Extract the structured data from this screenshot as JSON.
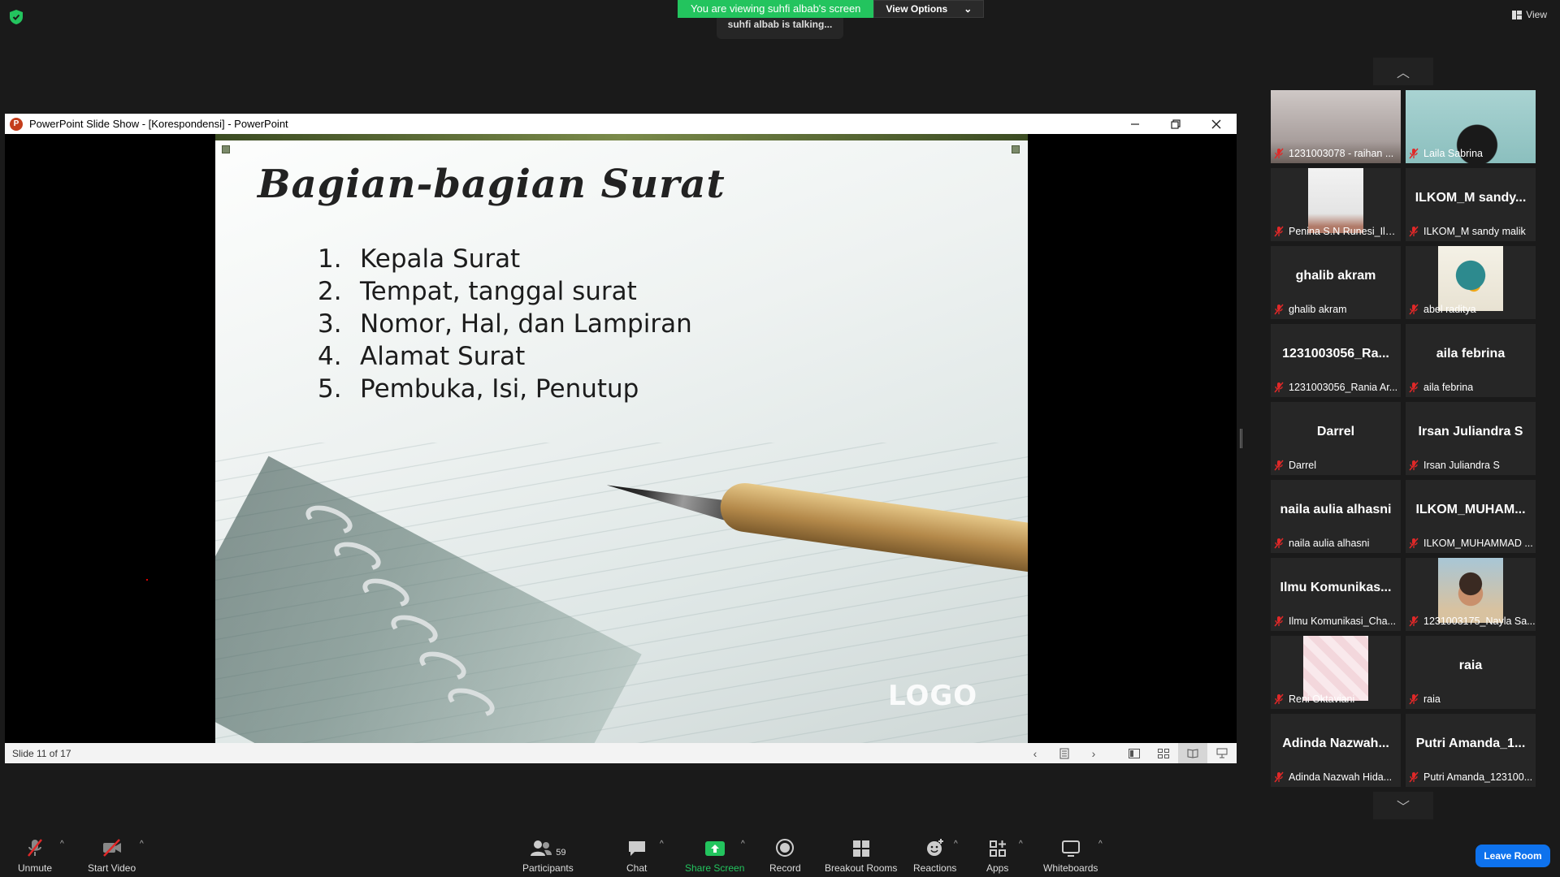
{
  "banner": {
    "viewing": "You are viewing suhfi albab's screen",
    "view_options": "View Options",
    "talking": "suhfi albab is talking..."
  },
  "top_view_label": "View",
  "ppt": {
    "title": "PowerPoint Slide Show - [Korespondensi] - PowerPoint",
    "status": "Slide 11 of 17"
  },
  "slide": {
    "title": "Bagian-bagian Surat",
    "items": [
      {
        "num": "1.",
        "text": "Kepala Surat"
      },
      {
        "num": "2.",
        "text": "Tempat, tanggal surat"
      },
      {
        "num": "3.",
        "text": "Nomor, Hal, dan Lampiran"
      },
      {
        "num": "4.",
        "text": "Alamat Surat"
      },
      {
        "num": "5.",
        "text": "Pembuka, Isi, Penutup"
      }
    ],
    "logo": "LOGO"
  },
  "participants": [
    {
      "big": "",
      "label": "1231003078 - raihan ..."
    },
    {
      "big": "",
      "label": "Laila  Sabrina"
    },
    {
      "big": "",
      "label": "Penina S.N Runesi_Ilm..."
    },
    {
      "big": "ILKOM_M  sandy...",
      "label": "ILKOM_M sandy malik"
    },
    {
      "big": "ghalib akram",
      "label": "ghalib akram"
    },
    {
      "big": "",
      "label": "abel raditya"
    },
    {
      "big": "1231003056_Ra...",
      "label": "1231003056_Rania Ar..."
    },
    {
      "big": "aila febrina",
      "label": "aila febrina"
    },
    {
      "big": "Darrel",
      "label": "Darrel"
    },
    {
      "big": "Irsan Juliandra S",
      "label": "Irsan Juliandra S"
    },
    {
      "big": "naila aulia alhasni",
      "label": "naila aulia alhasni"
    },
    {
      "big": "ILKOM_MUHAM...",
      "label": "ILKOM_MUHAMMAD ..."
    },
    {
      "big": "Ilmu  Komunikas...",
      "label": "Ilmu Komunikasi_Cha..."
    },
    {
      "big": "",
      "label": "1231003175_Nayla Sa..."
    },
    {
      "big": "",
      "label": "Reni Oktaviani"
    },
    {
      "big": "raia",
      "label": "raia"
    },
    {
      "big": "Adinda  Nazwah...",
      "label": "Adinda Nazwah Hida..."
    },
    {
      "big": "Putri  Amanda_1...",
      "label": "Putri Amanda_123100..."
    }
  ],
  "toolbar": {
    "unmute": "Unmute",
    "start_video": "Start Video",
    "participants": "Participants",
    "participants_count": "59",
    "chat": "Chat",
    "share_screen": "Share Screen",
    "record": "Record",
    "breakout": "Breakout Rooms",
    "reactions": "Reactions",
    "apps": "Apps",
    "whiteboards": "Whiteboards",
    "leave": "Leave Room"
  },
  "colors": {
    "share_green": "#23c45e",
    "leave_blue": "#0e72ed",
    "muted_red": "#e02828"
  }
}
